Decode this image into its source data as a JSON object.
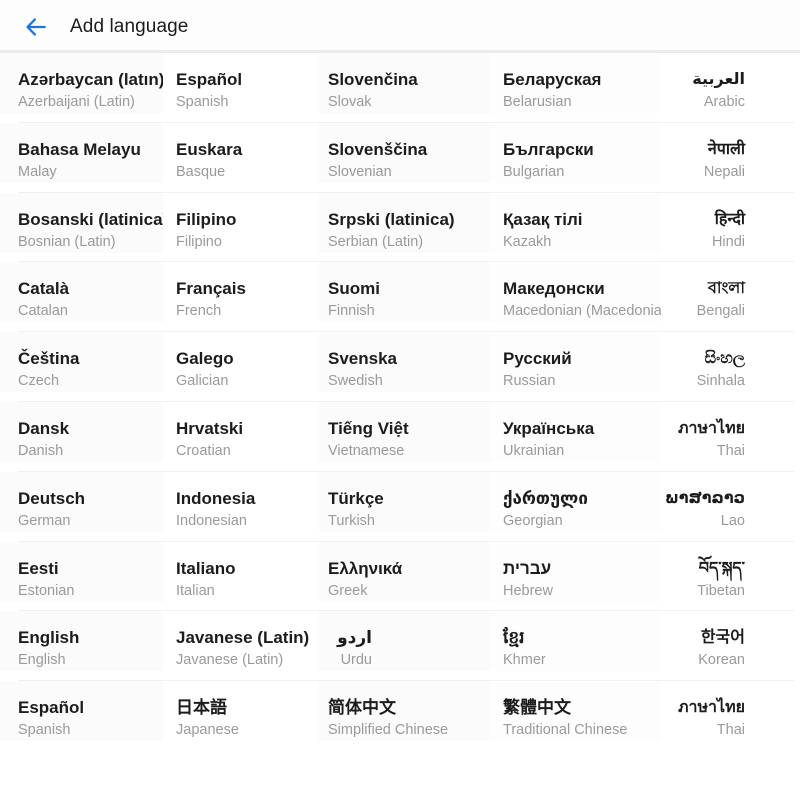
{
  "header": {
    "title": "Add language",
    "back_icon": "arrow-left-icon",
    "accent_color": "#1a73e8"
  },
  "grid": {
    "columns": 5,
    "rows": 11,
    "cells": [
      [
        {
          "native": "Azərbaycan (latın)",
          "english": "Azerbaijani (Latin)"
        },
        {
          "native": "Español",
          "english": "Spanish"
        },
        {
          "native": "Slovenčina",
          "english": "Slovak"
        },
        {
          "native": "Беларуская",
          "english": "Belarusian"
        },
        {
          "native": "العربية",
          "english": "Arabic",
          "rtl": true
        }
      ],
      [
        {
          "native": "Bahasa Melayu",
          "english": "Malay"
        },
        {
          "native": "Euskara",
          "english": "Basque"
        },
        {
          "native": "Slovenščina",
          "english": "Slovenian"
        },
        {
          "native": "Български",
          "english": "Bulgarian"
        },
        {
          "native": "नेपाली",
          "english": "Nepali"
        }
      ],
      [
        {
          "native": "Bosanski (latinica)",
          "english": "Bosnian (Latin)"
        },
        {
          "native": "Filipino",
          "english": "Filipino"
        },
        {
          "native": "Srpski (latinica)",
          "english": "Serbian (Latin)"
        },
        {
          "native": "Қазақ тілі",
          "english": "Kazakh"
        },
        {
          "native": "हिन्दी",
          "english": "Hindi"
        }
      ],
      [
        {
          "native": "Català",
          "english": "Catalan"
        },
        {
          "native": "Français",
          "english": "French"
        },
        {
          "native": "Suomi",
          "english": "Finnish"
        },
        {
          "native": "Македонски",
          "english": "Macedonian (Macedonia)"
        },
        {
          "native": "বাংলা",
          "english": "Bengali"
        }
      ],
      [
        {
          "native": "Čeština",
          "english": "Czech"
        },
        {
          "native": "Galego",
          "english": "Galician"
        },
        {
          "native": "Svenska",
          "english": "Swedish"
        },
        {
          "native": "Русский",
          "english": "Russian"
        },
        {
          "native": "සිංහල",
          "english": "Sinhala"
        }
      ],
      [
        {
          "native": "Dansk",
          "english": "Danish"
        },
        {
          "native": "Hrvatski",
          "english": "Croatian"
        },
        {
          "native": "Tiếng Việt",
          "english": "Vietnamese"
        },
        {
          "native": "Українська",
          "english": "Ukrainian"
        },
        {
          "native": "ภาษาไทย",
          "english": "Thai"
        }
      ],
      [
        {
          "native": "Deutsch",
          "english": "German"
        },
        {
          "native": "Indonesia",
          "english": "Indonesian"
        },
        {
          "native": "Türkçe",
          "english": "Turkish"
        },
        {
          "native": "ქართული",
          "english": "Georgian"
        },
        {
          "native": "ພາສາລາວ",
          "english": "Lao"
        }
      ],
      [
        {
          "native": "Eesti",
          "english": "Estonian"
        },
        {
          "native": "Italiano",
          "english": "Italian"
        },
        {
          "native": "Ελληνικά",
          "english": "Greek"
        },
        {
          "native": "עברית",
          "english": "Hebrew",
          "rtl": true
        },
        {
          "native": "བོད་སྐད་",
          "english": "Tibetan"
        }
      ],
      [
        {
          "native": "English",
          "english": "English"
        },
        {
          "native": "Javanese (Latin)",
          "english": "Javanese (Latin)"
        },
        {
          "native": "اردو",
          "english": "Urdu",
          "rtl": true
        },
        {
          "native": "ខ្មែរ",
          "english": "Khmer"
        },
        {
          "native": "한국어",
          "english": "Korean"
        }
      ],
      [
        {
          "native": "Español",
          "english": "Spanish"
        },
        {
          "native": "日本語",
          "english": "Japanese"
        },
        {
          "native": "简体中文",
          "english": "Simplified Chinese"
        },
        {
          "native": "繁體中文",
          "english": "Traditional Chinese"
        },
        {
          "native": "ภาษาไทย",
          "english": "Thai"
        }
      ]
    ]
  }
}
